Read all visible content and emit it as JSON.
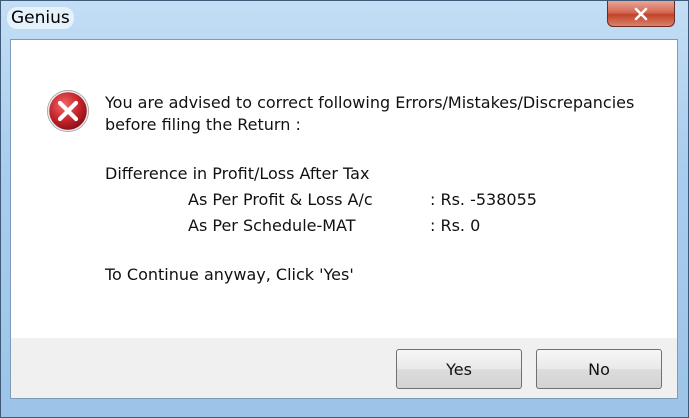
{
  "window": {
    "title": "Genius"
  },
  "message": {
    "line1": "You are advised to correct following Errors/Mistakes/Discrepancies",
    "line2": "before filing the Return :",
    "difference_heading": "Difference in Profit/Loss After Tax",
    "rows": [
      {
        "label": "As Per Profit & Loss A/c",
        "value": ": Rs. -538055"
      },
      {
        "label": "As Per Schedule-MAT",
        "value": ": Rs. 0"
      }
    ],
    "continue_text": "To Continue anyway, Click 'Yes'"
  },
  "buttons": {
    "yes_label": "Yes",
    "no_label": "No"
  },
  "icons": {
    "error": "error-icon",
    "close": "close-icon"
  },
  "colors": {
    "error_red": "#c8242c",
    "close_button": "#c4432a",
    "frame_blue": "#a9cdee"
  }
}
